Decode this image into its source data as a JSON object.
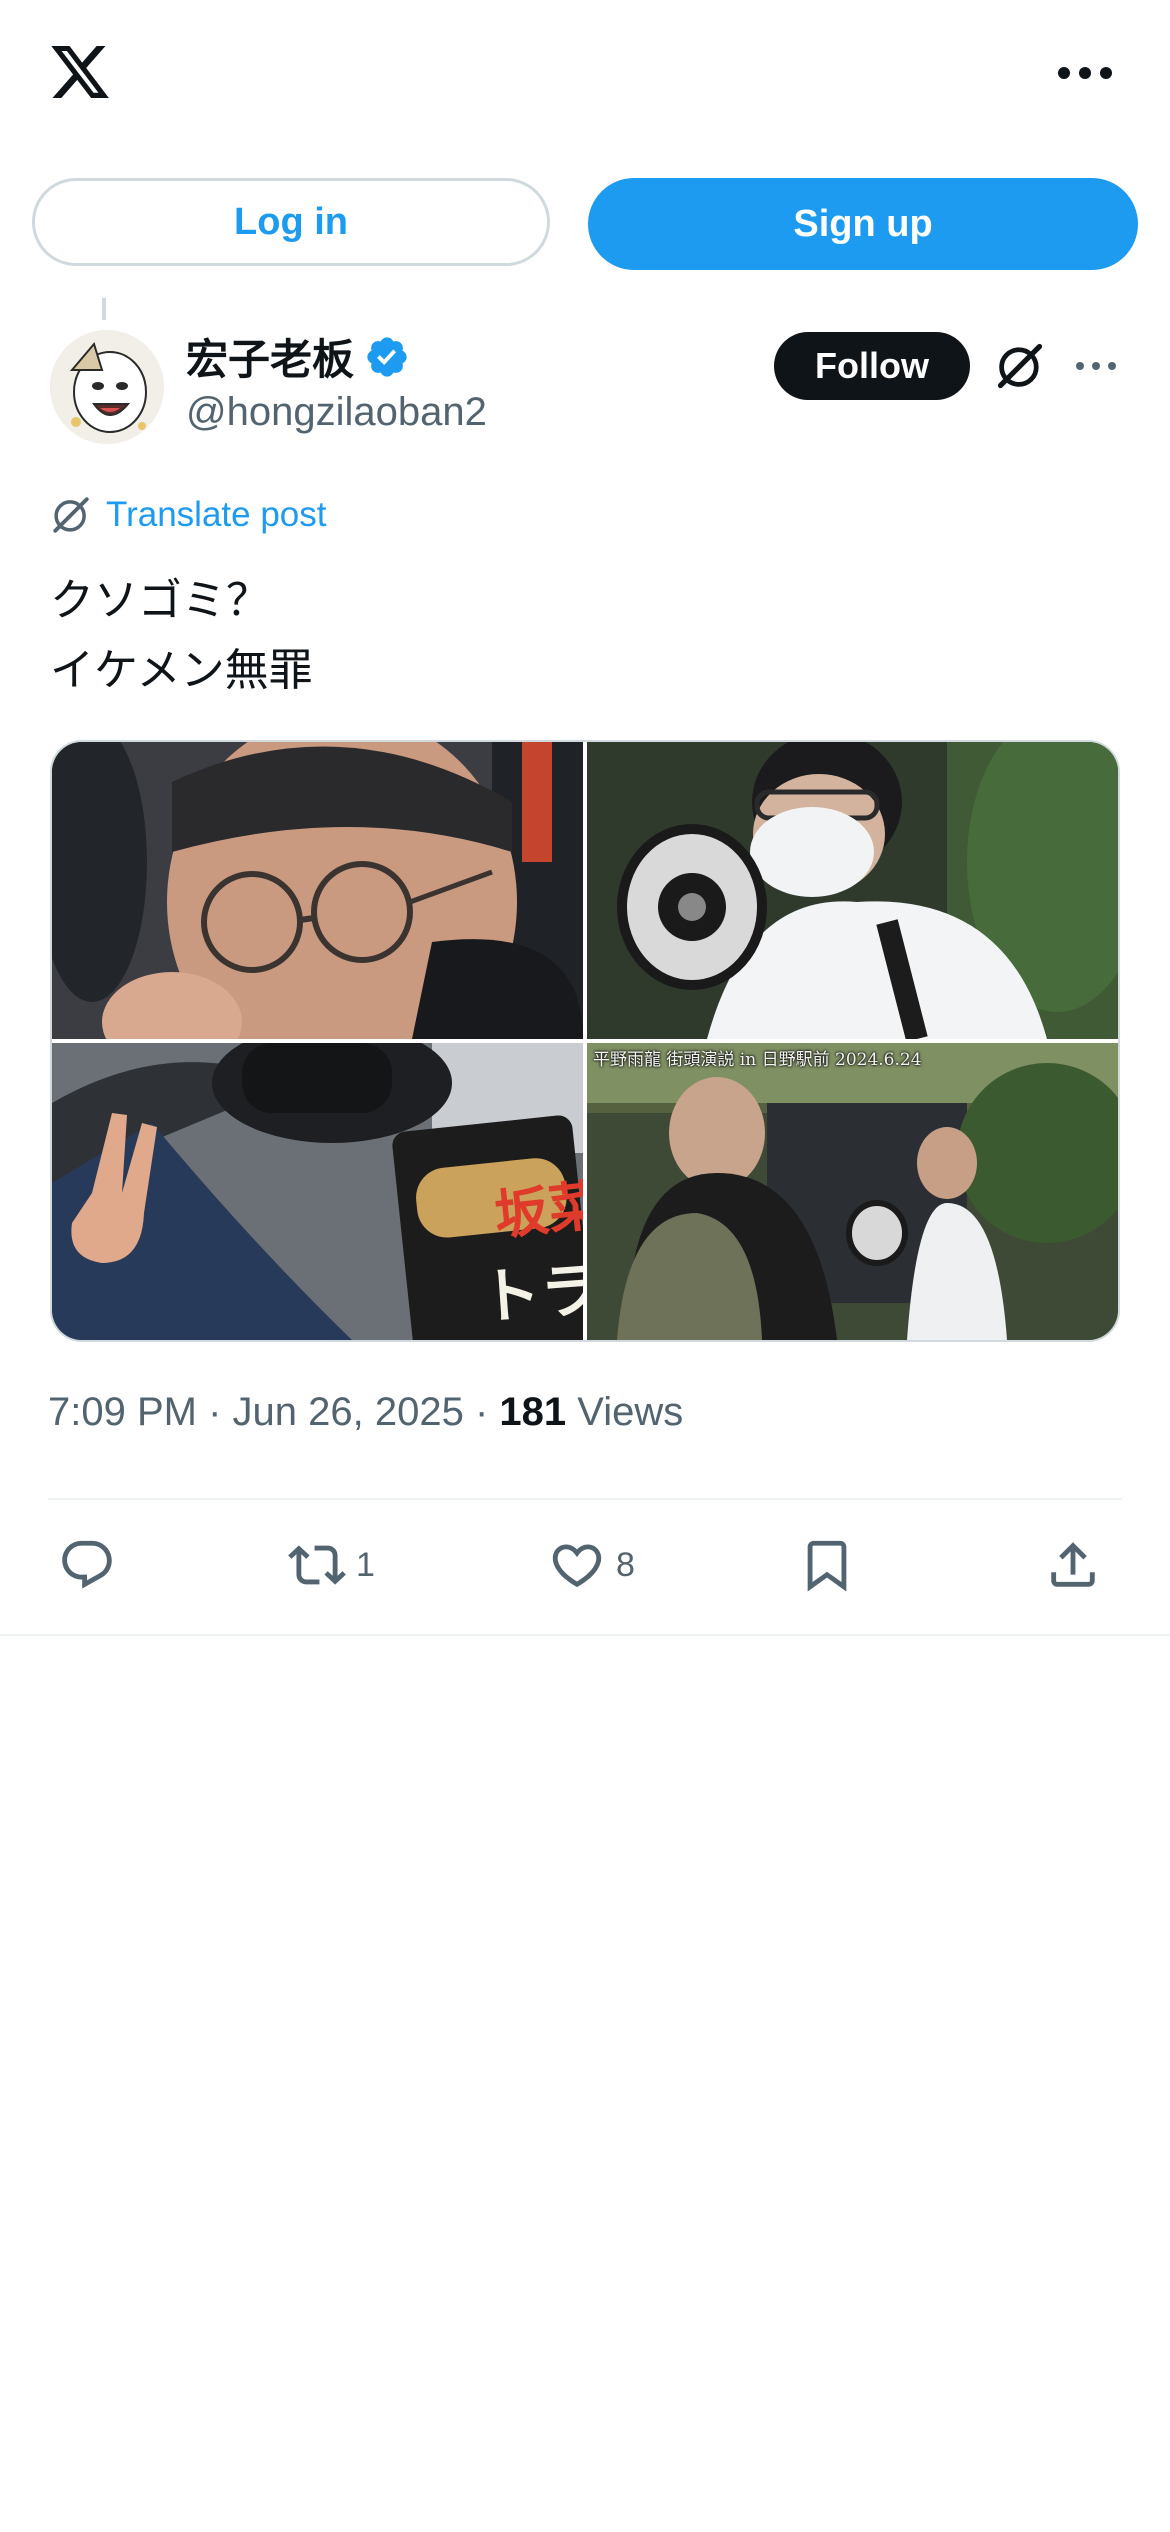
{
  "header": {
    "logo_icon": "x-logo-icon",
    "more_icon": "more-horizontal-icon"
  },
  "auth": {
    "login_label": "Log in",
    "signup_label": "Sign up"
  },
  "post": {
    "author": {
      "display_name": "宏子老板",
      "handle": "@hongzilaoban2",
      "verified": true,
      "follow_label": "Follow"
    },
    "translate_label": "Translate post",
    "text_lines": [
      "クソゴミ？",
      "イケメン無罪"
    ],
    "media": {
      "count": 4,
      "image_3_sign_text_1": "坂菜む",
      "image_3_sign_text_2": "トランス差",
      "image_4_caption": "平野雨龍 街頭演説 in 日野駅前 2024.6.24"
    },
    "timestamp": "7:09 PM · Jun 26, 2025",
    "separator": " · ",
    "views_count": "181",
    "views_label": "Views",
    "actions": {
      "reply_count": "",
      "repost_count": "1",
      "like_count": "8"
    }
  },
  "colors": {
    "accent": "#1d9bf0",
    "text": "#0f1419",
    "muted": "#536471",
    "border": "#cfd9de"
  }
}
